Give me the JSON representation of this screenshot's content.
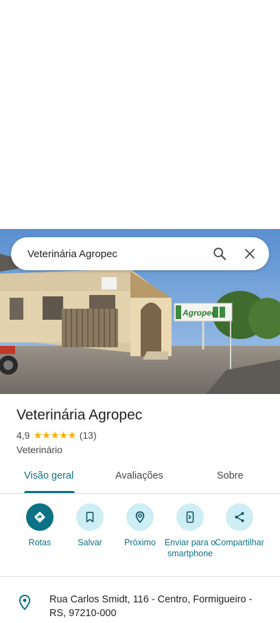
{
  "search": {
    "query": "Veterinária Agropec"
  },
  "place": {
    "name": "Veterinária Agropec",
    "rating": "4,9",
    "stars": "★★★★★",
    "reviews_count": "(13)",
    "category": "Veterinário",
    "sign_text": "Agropec"
  },
  "tabs": [
    {
      "label": "Visão geral"
    },
    {
      "label": "Avaliações"
    },
    {
      "label": "Sobre"
    }
  ],
  "actions": [
    {
      "label": "Rotas",
      "icon": "directions-icon"
    },
    {
      "label": "Salvar",
      "icon": "bookmark-icon"
    },
    {
      "label": "Próximo",
      "icon": "nearby-icon"
    },
    {
      "label": "Enviar para o smartphone",
      "icon": "send-to-phone-icon"
    },
    {
      "label": "Compartilhar",
      "icon": "share-icon"
    }
  ],
  "address": "Rua Carlos Smidt, 116 - Centro, Formigueiro - RS, 97210-000",
  "colors": {
    "accent": "#0b7285",
    "accent_light": "#cdeef4",
    "star": "#f4b400"
  }
}
